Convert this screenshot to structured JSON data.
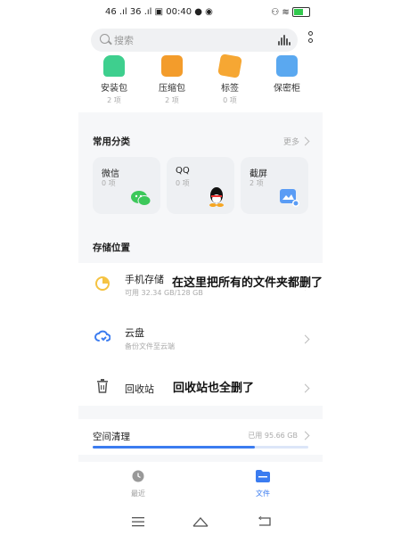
{
  "status_bar": {
    "left": "46 .ıl 36 .ıl ▣ 00:40 ● ◉",
    "right": "⚇ ≋"
  },
  "search": {
    "placeholder": "搜索"
  },
  "top_categories": [
    {
      "label": "安装包",
      "count": "2 项",
      "color": "#3ecf8e"
    },
    {
      "label": "压缩包",
      "count": "2 项",
      "color": "#f39c2b"
    },
    {
      "label": "标签",
      "count": "0 项",
      "color": "#f6a733"
    },
    {
      "label": "保密柜",
      "count": "",
      "color": "#5aa8f0"
    }
  ],
  "common": {
    "title": "常用分类",
    "more": "更多",
    "cards": [
      {
        "label": "微信",
        "count": "0 项",
        "icon": "wechat-icon"
      },
      {
        "label": "QQ",
        "count": "0 项",
        "icon": "qq-icon"
      },
      {
        "label": "截屏",
        "count": "2 项",
        "icon": "screenshot-icon"
      }
    ]
  },
  "storage": {
    "title": "存储位置",
    "phone": {
      "label": "手机存储",
      "sub": "可用 32.34 GB/128 GB",
      "annotation": "在这里把所有的文件夹都删了"
    },
    "cloud": {
      "label": "云盘",
      "sub": "备份文件至云端"
    },
    "trash": {
      "label": "回收站",
      "annotation": "回收站也全删了"
    }
  },
  "space": {
    "label": "空间清理",
    "used": "已用 95.66 GB",
    "fraction": 0.75
  },
  "bottom_nav": [
    {
      "label": "最近",
      "icon": "clock-icon"
    },
    {
      "label": "文件",
      "icon": "folder-icon"
    }
  ],
  "colors": {
    "accent": "#3b7cf0",
    "phone_storage": "#f5c342",
    "cloud": "#3b7cf0"
  }
}
